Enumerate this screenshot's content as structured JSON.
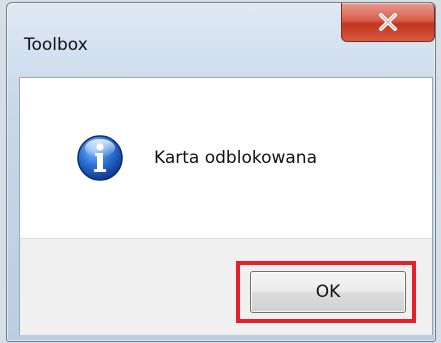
{
  "window": {
    "title": "Toolbox",
    "close_icon": "close-icon"
  },
  "dialog": {
    "icon": "info-icon",
    "message": "Karta odblokowana",
    "ok_label": "OK"
  },
  "colors": {
    "highlight": "#e3202a",
    "close_button": "#c3341e",
    "icon_blue": "#1f5fbf"
  }
}
